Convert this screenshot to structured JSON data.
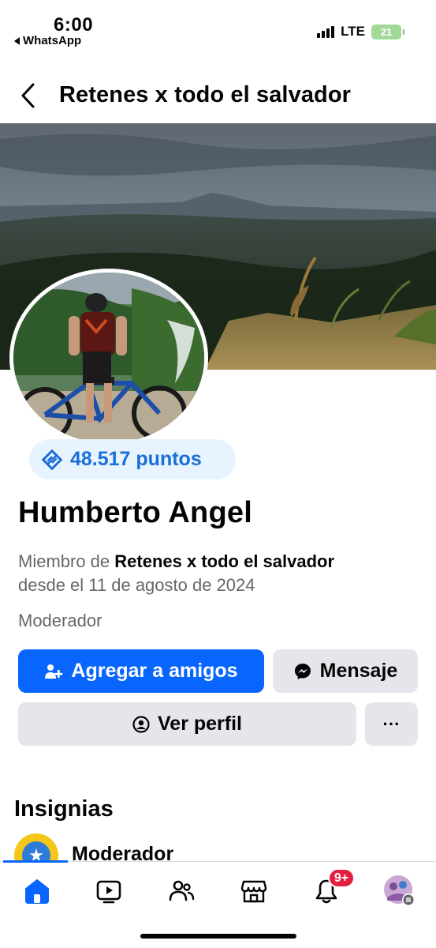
{
  "status_bar": {
    "time": "6:00",
    "back_app": "WhatsApp",
    "network": "LTE",
    "battery": "21"
  },
  "header": {
    "title": "Retenes x todo el salvador"
  },
  "profile": {
    "points": "48.517 puntos",
    "name": "Humberto Angel",
    "member_prefix": "Miembro de",
    "member_group": "Retenes x todo el salvador",
    "member_since": "desde el 11 de agosto de 2024",
    "role": "Moderador"
  },
  "actions": {
    "add_friend": "Agregar a amigos",
    "message": "Mensaje",
    "view_profile": "Ver perfil",
    "more": "···"
  },
  "badges": {
    "title": "Insignias",
    "items": [
      {
        "label": "Moderador",
        "icon": "star-icon"
      }
    ]
  },
  "bottom_nav": {
    "items": [
      {
        "name": "home",
        "icon": "home-icon",
        "active": true
      },
      {
        "name": "video",
        "icon": "video-icon",
        "active": false
      },
      {
        "name": "friends",
        "icon": "friends-icon",
        "active": false
      },
      {
        "name": "marketplace",
        "icon": "marketplace-icon",
        "active": false
      },
      {
        "name": "notifications",
        "icon": "bell-icon",
        "active": false
      },
      {
        "name": "menu",
        "icon": "profile-menu-icon",
        "active": false
      }
    ],
    "notifications_badge": "9+"
  },
  "colors": {
    "primary": "#0866ff",
    "points_text": "#1b6fd8",
    "points_bg": "#e7f3ff",
    "secondary_button": "#e4e6eb",
    "muted_text": "#65676b",
    "notification_red": "#e41e3f"
  }
}
